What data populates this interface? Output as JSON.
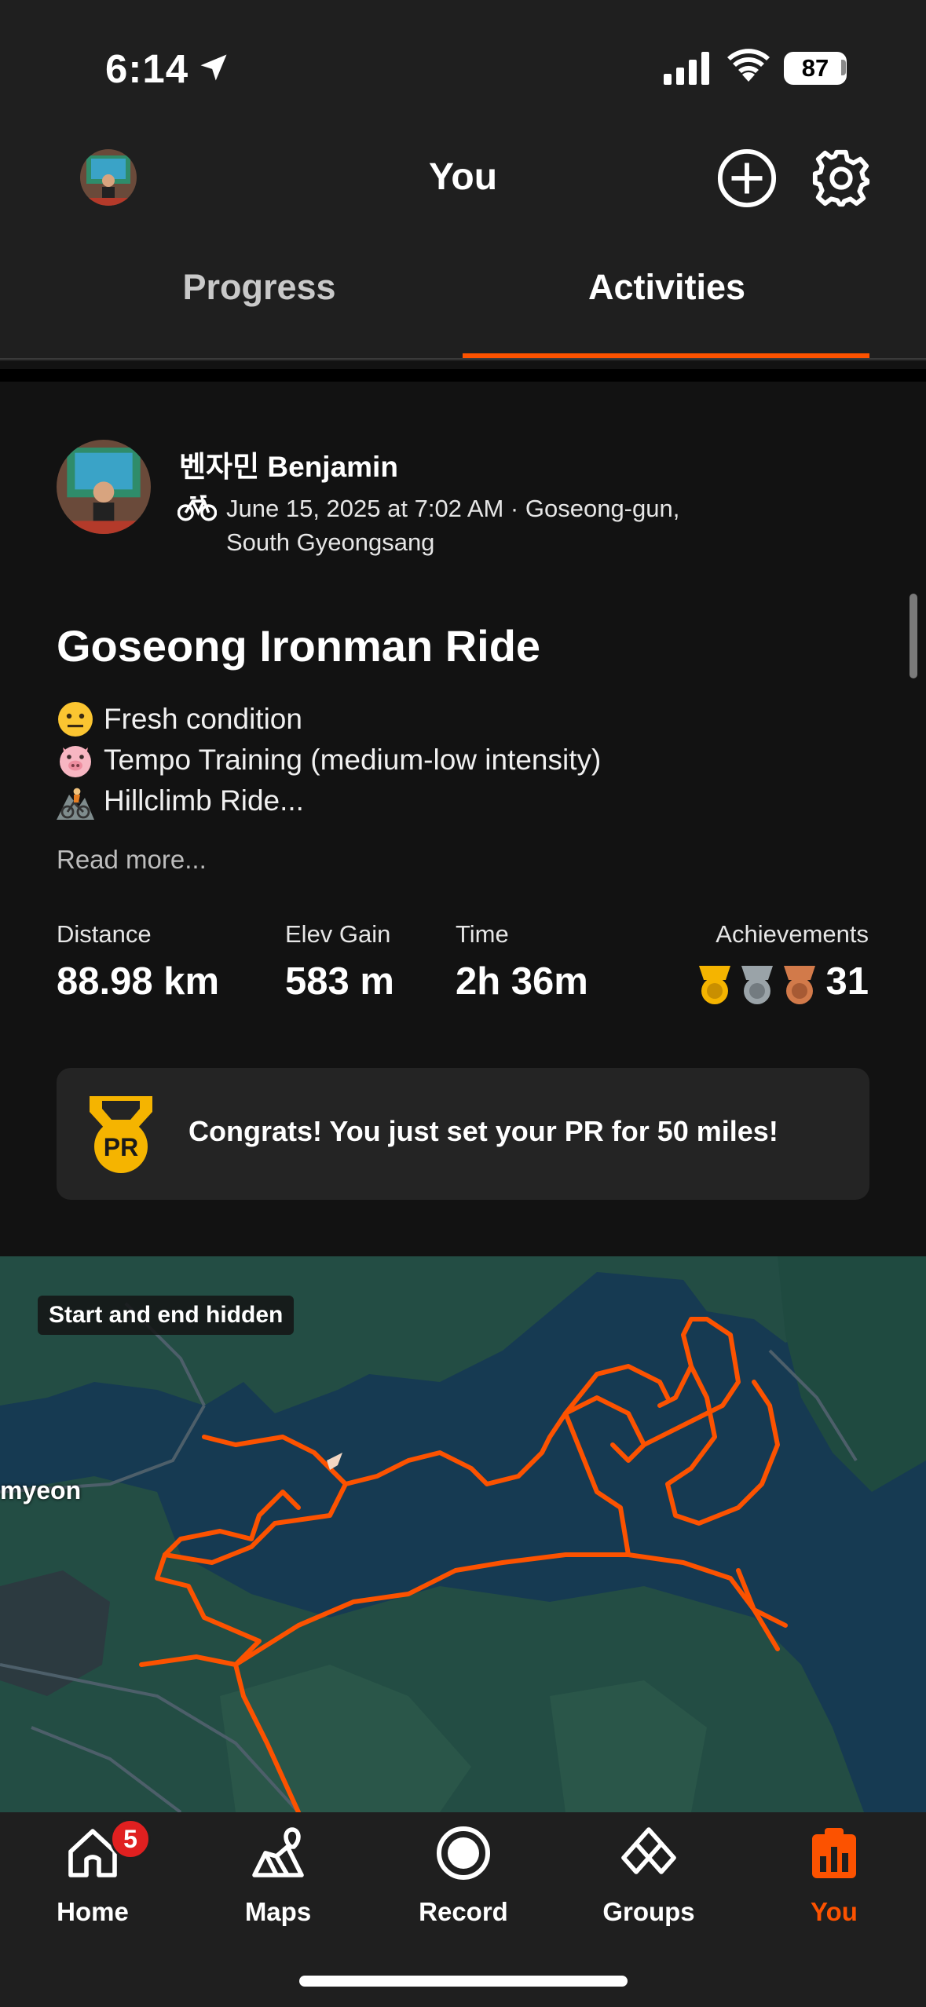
{
  "status_bar": {
    "time": "6:14",
    "battery": "87"
  },
  "header": {
    "title": "You"
  },
  "tabs": [
    {
      "label": "Progress",
      "active": false
    },
    {
      "label": "Activities",
      "active": true
    }
  ],
  "activity": {
    "athlete": "벤자민 Benjamin",
    "meta": "June 15, 2025 at 7:02 AM · Goseong-gun, South Gyeongsang",
    "title": "Goseong Ironman Ride",
    "description": [
      {
        "emoji": "neutral-face",
        "text": "Fresh condition"
      },
      {
        "emoji": "pig-face",
        "text": "Tempo Training (medium-low intensity)"
      },
      {
        "emoji": "mountain-bicyclist",
        "text": "Hillclimb Ride..."
      }
    ],
    "read_more": "Read more...",
    "stats": {
      "distance": {
        "label": "Distance",
        "value": "88.98 km"
      },
      "elev_gain": {
        "label": "Elev Gain",
        "value": "583 m"
      },
      "time": {
        "label": "Time",
        "value": "2h 36m"
      },
      "achievements": {
        "label": "Achievements",
        "value": "31"
      }
    },
    "pr_banner": {
      "icon": "PR",
      "text": "Congrats! You just set your PR for 50 miles!"
    }
  },
  "map": {
    "badge": "Start and end hidden",
    "place_label": "myeon"
  },
  "bottom_nav": [
    {
      "label": "Home",
      "icon": "home-icon",
      "badge": "5"
    },
    {
      "label": "Maps",
      "icon": "maps-icon"
    },
    {
      "label": "Record",
      "icon": "record-icon"
    },
    {
      "label": "Groups",
      "icon": "groups-icon"
    },
    {
      "label": "You",
      "icon": "you-icon",
      "active": true
    }
  ],
  "colors": {
    "accent": "#fc5200",
    "background": "#121212",
    "bar": "#1f1f1f",
    "badge": "#e02020"
  }
}
